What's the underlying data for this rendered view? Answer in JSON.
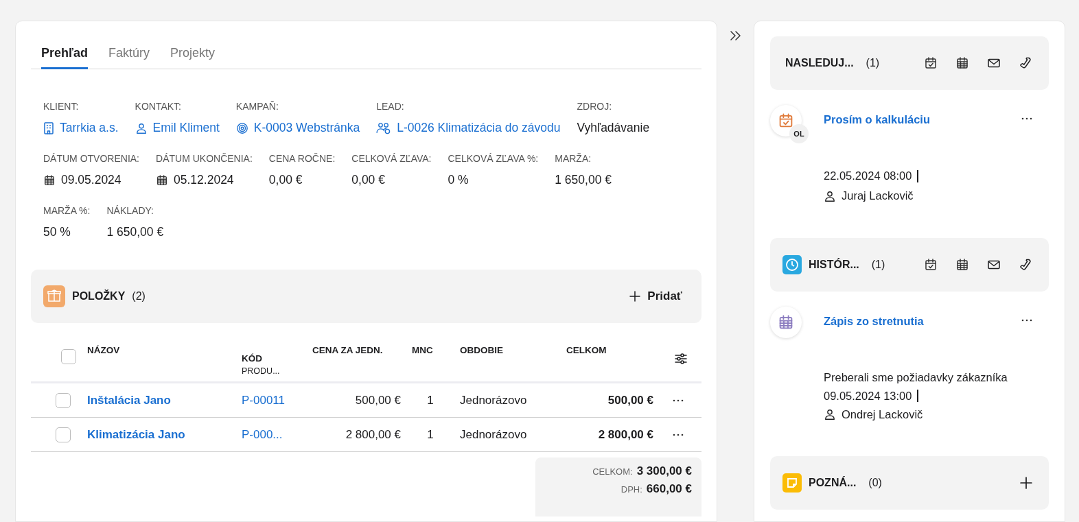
{
  "tabs": [
    {
      "label": "Prehľad",
      "selected": true
    },
    {
      "label": "Faktúry",
      "selected": false
    },
    {
      "label": "Projekty",
      "selected": false
    }
  ],
  "detail_rows": [
    {
      "fields": [
        {
          "label": "KLIENT:",
          "value": "Tarrkia a.s.",
          "kind": "link"
        },
        {
          "label": "KONTAKT:",
          "value": "Emil Kliment",
          "kind": "link"
        },
        {
          "label": "KAMPAŇ:",
          "value": "K-0003 Webstránka",
          "kind": "link"
        },
        {
          "label": "LEAD:",
          "value": "L-0026 Klimatizácia do závodu",
          "kind": "link"
        },
        {
          "label": "ZDROJ:",
          "value": "Vyhľadávanie",
          "kind": "text"
        }
      ]
    },
    {
      "fields": [
        {
          "label": "DÁTUM OTVORENIA:",
          "value": "09.05.2024",
          "kind": "date"
        },
        {
          "label": "DÁTUM UKONČENIA:",
          "value": "05.12.2024",
          "kind": "date"
        },
        {
          "label": "CENA ROČNE:",
          "value": "0,00 €",
          "kind": "text"
        },
        {
          "label": "CELKOVÁ ZĽAVA:",
          "value": "0,00 €",
          "kind": "text"
        },
        {
          "label": "CELKOVÁ ZĽAVA %:",
          "value": "0 %",
          "kind": "text"
        },
        {
          "label": "MARŽA:",
          "value": "1 650,00 €",
          "kind": "text"
        }
      ]
    },
    {
      "fields": [
        {
          "label": "MARŽA %:",
          "value": "50 %",
          "kind": "text"
        },
        {
          "label": "NÁKLADY:",
          "value": "1 650,00 €",
          "kind": "text"
        }
      ]
    }
  ],
  "items_section": {
    "title": "POLOŽKY",
    "count": "(2)",
    "add_label": "Pridať"
  },
  "table": {
    "select_all_checked": false,
    "columns": [
      {
        "label": "NÁZOV"
      },
      {
        "label": "KÓD",
        "sublabel": "PRODU..."
      },
      {
        "label": "CENA ZA JEDN."
      },
      {
        "label": "MNC"
      },
      {
        "label": "OBDOBIE"
      },
      {
        "label": "CELKOM"
      }
    ],
    "rows": [
      {
        "checked": false,
        "name": "Inštalácia Jano",
        "code": "P-00011",
        "unit_price": "500,00 €",
        "qty": "1",
        "period": "Jednorázovo",
        "total": "500,00 €"
      },
      {
        "checked": false,
        "name": "Klimatizácia Jano",
        "code": "P-000...",
        "unit_price": "2 800,00 €",
        "qty": "1",
        "period": "Jednorázovo",
        "total": "2 800,00 €"
      }
    ]
  },
  "totals": [
    {
      "label": "CELKOM:",
      "value": "3 300,00 €"
    },
    {
      "label": "DPH:",
      "value": "660,00 €"
    }
  ],
  "side": {
    "upcoming": {
      "title": "NASLEDUJ...",
      "count": "(1)",
      "items": [
        {
          "title": "Prosím o kalkuláciu",
          "badge": "OL",
          "datetime": "22.05.2024 08:00",
          "person": "Juraj Lackovič"
        }
      ]
    },
    "history": {
      "title": "HISTÓR...",
      "count": "(1)",
      "items": [
        {
          "title": "Zápis zo stretnutia",
          "description": "Preberali sme požiadavky zákazníka",
          "datetime": "09.05.2024 13:00",
          "person": "Ondrej Lackovič"
        }
      ]
    },
    "notes": {
      "title": "POZNÁ...",
      "count": "(0)"
    }
  }
}
